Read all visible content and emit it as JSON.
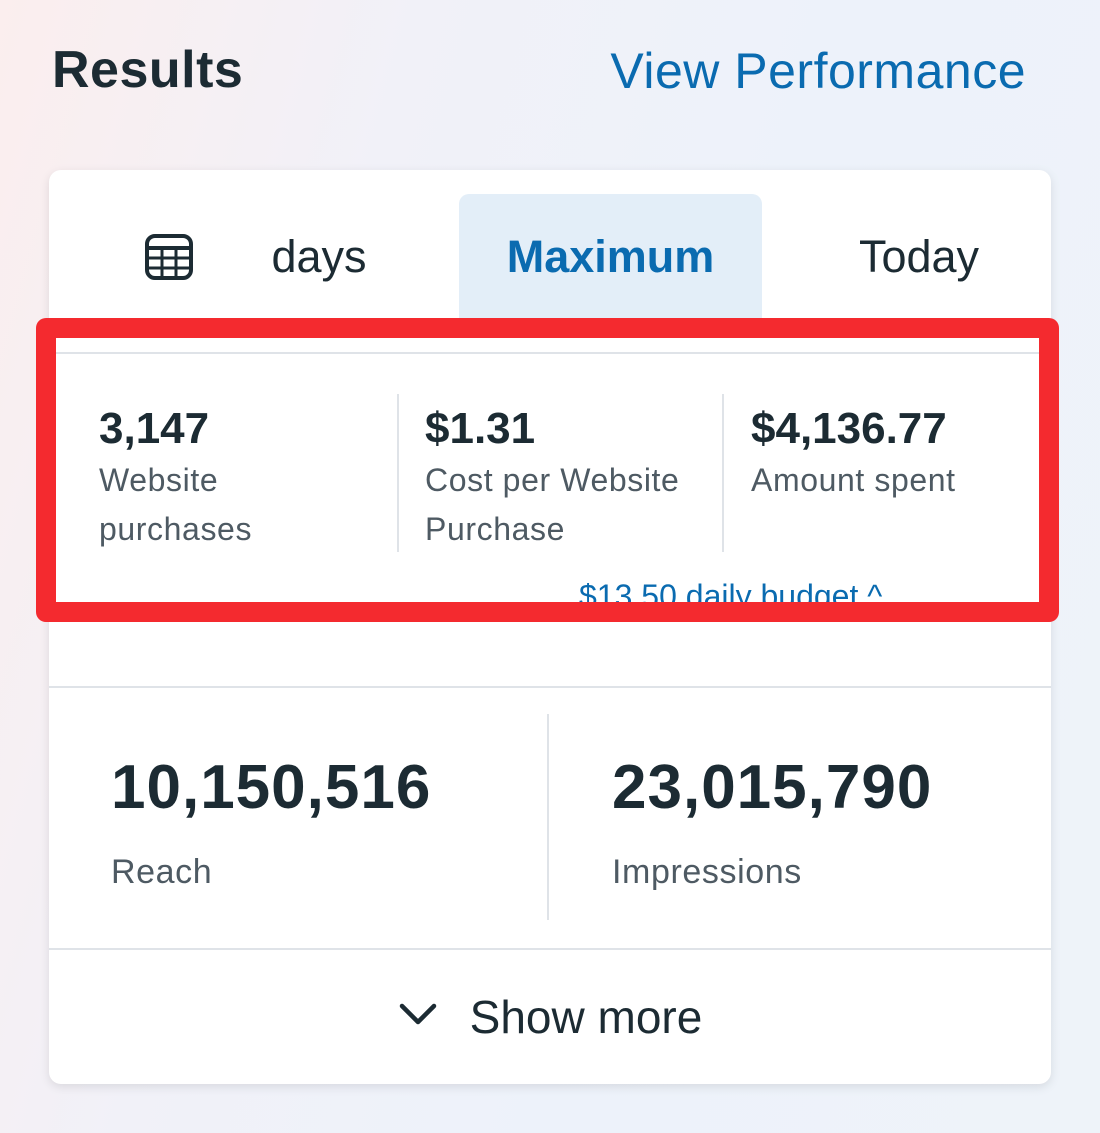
{
  "header": {
    "title": "Results",
    "link": "View Performance"
  },
  "tabs": {
    "calendar_icon": "calendar-icon",
    "days": "days",
    "maximum": "Maximum",
    "today": "Today",
    "selected": "Maximum"
  },
  "metrics_top": [
    {
      "value": "3,147",
      "label_line1": "Website",
      "label_line2": "purchases"
    },
    {
      "value": "$1.31",
      "label_line1": "Cost per Website",
      "label_line2": "Purchase"
    },
    {
      "value": "$4,136.77",
      "label_line1": "Amount spent",
      "label_line2": ""
    }
  ],
  "budget": "$13.50 daily budget ^",
  "metrics_bottom": [
    {
      "value": "10,150,516",
      "label": "Reach"
    },
    {
      "value": "23,015,790",
      "label": "Impressions"
    }
  ],
  "show_more": {
    "label": "Show more",
    "icon": "chevron-down-icon"
  },
  "colors": {
    "accent": "#0a6bb0",
    "highlight": "#f42a2f",
    "tab_selected_bg": "#e3eef8",
    "text": "#1c2b33"
  }
}
